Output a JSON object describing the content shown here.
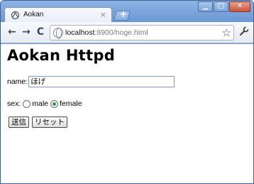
{
  "tab": {
    "title": "Aokan",
    "close_glyph": "×",
    "favicon": "aokan-favicon-icon"
  },
  "new_tab": {
    "glyph": "+"
  },
  "window_controls": {
    "minimize": "▁",
    "maximize": "□",
    "close": "✕"
  },
  "toolbar": {
    "back_glyph": "←",
    "forward_glyph": "→",
    "reload_glyph": "C",
    "url_host": "localhost",
    "url_rest": ":8900/hoge.html",
    "star_glyph": "☆",
    "wrench_glyph": "🔧"
  },
  "page": {
    "heading": "Aokan Httpd",
    "name_label": "name:",
    "name_value": "ほげ",
    "sex_label": "sex:",
    "sex_options": [
      {
        "label": "male",
        "checked": false
      },
      {
        "label": "female",
        "checked": true
      }
    ],
    "submit_label": "送信",
    "reset_label": "リセット"
  },
  "colors": {
    "window_frame": "#6f9ad6",
    "radio_checked": "#3a9a3a"
  }
}
